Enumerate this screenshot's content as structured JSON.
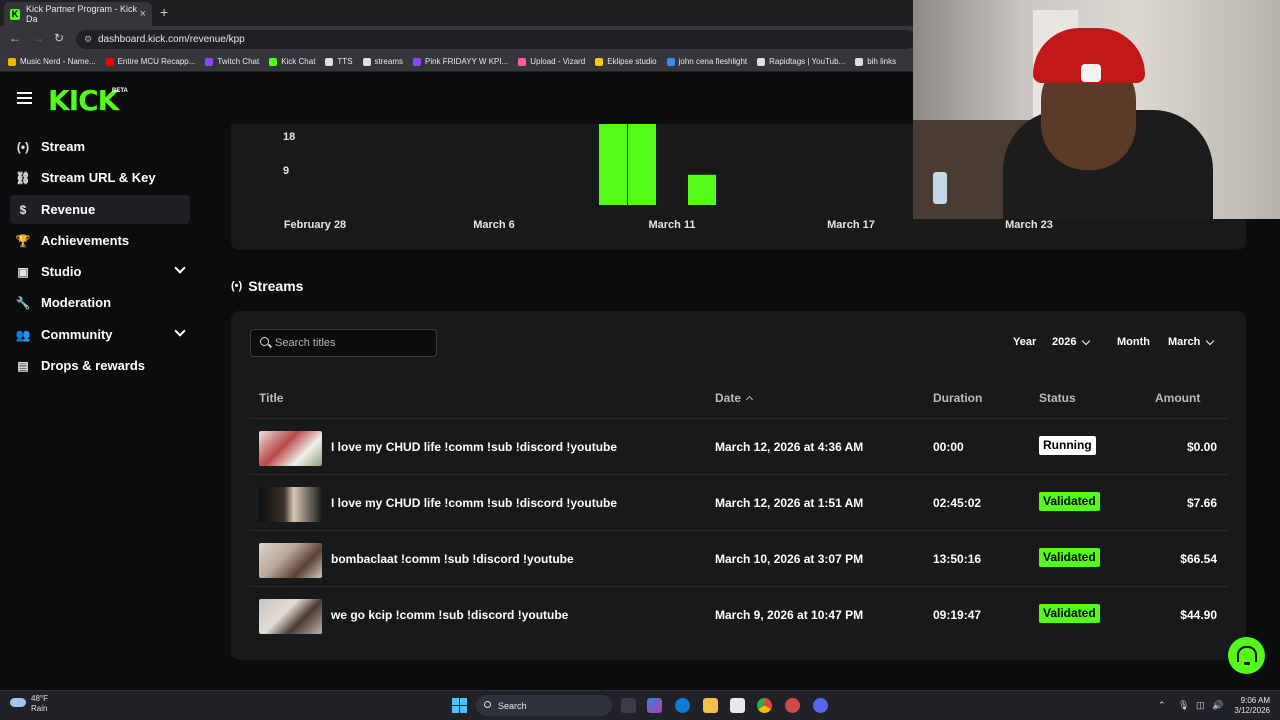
{
  "browser": {
    "tab_title": "Kick Partner Program - Kick Da",
    "tab_close": "×",
    "new_tab": "+",
    "url": "dashboard.kick.com/revenue/kpp",
    "back": "←",
    "forward": "→",
    "reload": "↻",
    "bookmarks": [
      {
        "label": "Music Nerd - Name...",
        "color": "#f4b400"
      },
      {
        "label": "Entire MCU Recapp...",
        "color": "#ff0000"
      },
      {
        "label": "Twitch Chat",
        "color": "#9146ff"
      },
      {
        "label": "Kick Chat",
        "color": "#53fc18"
      },
      {
        "label": "TTS",
        "color": "#dddddd"
      },
      {
        "label": "streams",
        "color": "#dddddd"
      },
      {
        "label": "Pink FRIDAYY W KPI...",
        "color": "#9146ff"
      },
      {
        "label": "Upload - Vizard",
        "color": "#ff5ca8"
      },
      {
        "label": "Eklipse studio",
        "color": "#ffcc00"
      },
      {
        "label": "john cena fleshlight",
        "color": "#4285f4"
      },
      {
        "label": "Rapidtags | YouTub...",
        "color": "#dddddd"
      },
      {
        "label": "bih links",
        "color": "#dddddd"
      }
    ]
  },
  "brand": {
    "logo": "KICK",
    "badge": "BETA",
    "accent": "#53fc18"
  },
  "sidebar": {
    "items": [
      {
        "label": "Stream",
        "icon": "(•)",
        "icon_name": "broadcast-icon"
      },
      {
        "label": "Stream URL & Key",
        "icon": "⛓",
        "icon_name": "link-icon"
      },
      {
        "label": "Revenue",
        "icon": "$",
        "icon_name": "dollar-icon",
        "active": true
      },
      {
        "label": "Achievements",
        "icon": "🏆",
        "icon_name": "trophy-icon"
      },
      {
        "label": "Studio",
        "icon": "▣",
        "icon_name": "studio-icon",
        "expandable": true
      },
      {
        "label": "Moderation",
        "icon": "🔧",
        "icon_name": "wrench-icon"
      },
      {
        "label": "Community",
        "icon": "👥",
        "icon_name": "users-icon",
        "expandable": true
      },
      {
        "label": "Drops & rewards",
        "icon": "▤",
        "icon_name": "drops-icon"
      }
    ]
  },
  "chart_data": {
    "type": "bar",
    "yticks": [
      "18",
      "9"
    ],
    "xticks": [
      "February 28",
      "March 6",
      "March 11",
      "March 17",
      "March 23"
    ],
    "bars": [
      {
        "date": "March 9",
        "value": 24
      },
      {
        "date": "March 10",
        "value": 24
      },
      {
        "date": "March 12",
        "value": 8
      }
    ]
  },
  "streams": {
    "heading": "Streams",
    "search_placeholder": "Search titles",
    "year_label": "Year",
    "year_value": "2026",
    "month_label": "Month",
    "month_value": "March",
    "columns": [
      "Title",
      "Date",
      "Duration",
      "Status",
      "Amount"
    ],
    "rows": [
      {
        "title": "I love my CHUD life !comm !sub !discord !youtube",
        "date": "March 12, 2026 at 4:36 AM",
        "duration": "00:00",
        "status": "Running",
        "amount": "$0.00"
      },
      {
        "title": "I love my CHUD life !comm !sub !discord !youtube",
        "date": "March 12, 2026 at 1:51 AM",
        "duration": "02:45:02",
        "status": "Validated",
        "amount": "$7.66"
      },
      {
        "title": "bombaclaat !comm !sub !discord !youtube",
        "date": "March 10, 2026 at 3:07 PM",
        "duration": "13:50:16",
        "status": "Validated",
        "amount": "$66.54"
      },
      {
        "title": "we go kcip !comm !sub !discord !youtube",
        "date": "March 9, 2026 at 10:47 PM",
        "duration": "09:19:47",
        "status": "Validated",
        "amount": "$44.90"
      }
    ]
  },
  "taskbar": {
    "temp": "48°F",
    "weather": "Rain",
    "search": "Search",
    "time": "9:06 AM",
    "date": "3/12/2026"
  }
}
